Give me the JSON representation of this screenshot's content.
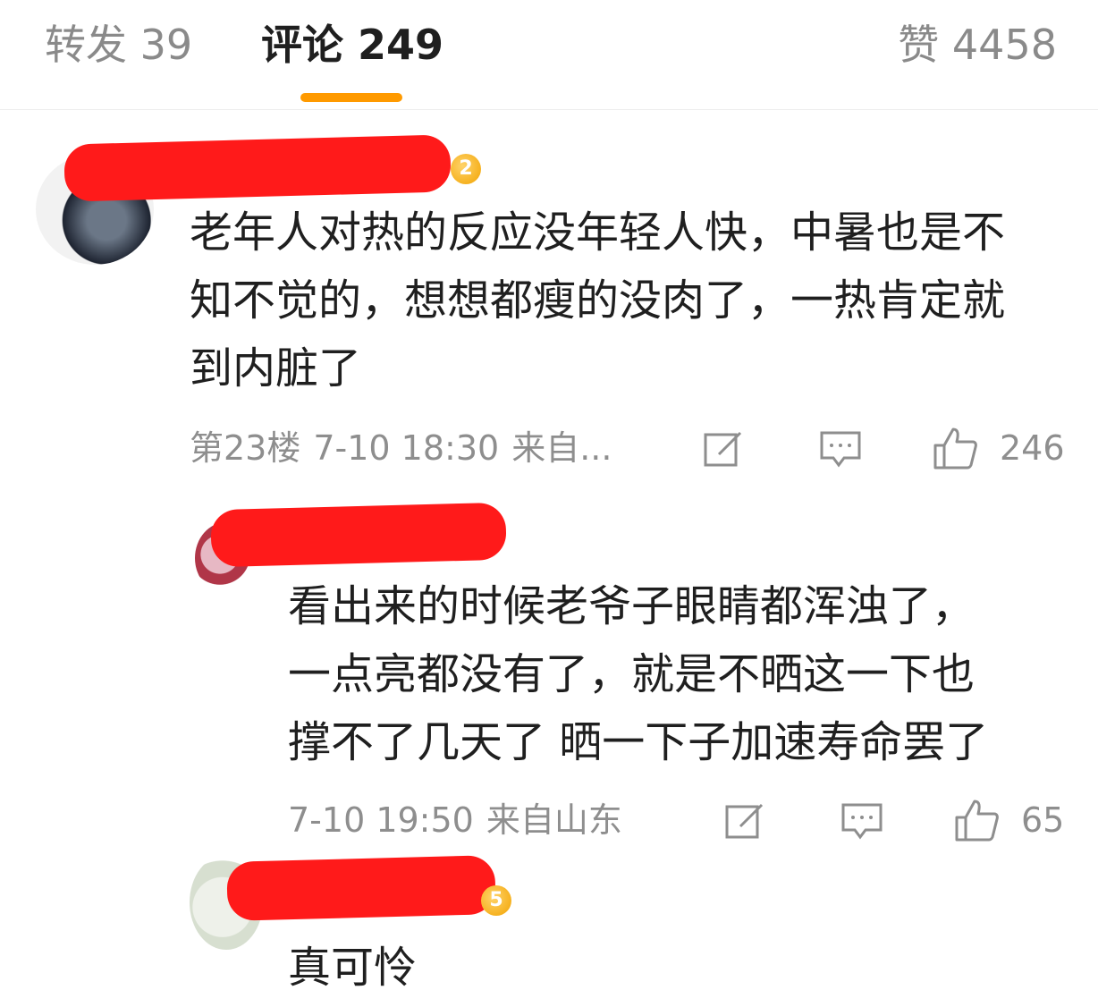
{
  "tabs": {
    "repost": "转发 39",
    "comments": "评论 249",
    "likes": "赞 4458"
  },
  "comments": [
    {
      "badge": "2",
      "text_lines": [
        "老年人对热的反应没年轻人快，中暑也是不",
        "知不觉的，想想都瘦的没肉了，一热肯定就",
        "到内脏了"
      ],
      "floor": "第23楼",
      "time": "7-10 18:30",
      "source": "来自...",
      "like_count": "246"
    },
    {
      "text_lines": [
        "看出来的时候老爷子眼睛都浑浊了，",
        "一点亮都没有了，就是不晒这一下也",
        "撑不了几天了  晒一下子加速寿命罢了"
      ],
      "time": "7-10 19:50",
      "source": "来自山东",
      "like_count": "65"
    },
    {
      "badge": "5",
      "text_lines": [
        "真可怜"
      ]
    }
  ],
  "icons": {
    "edit": "edit-square-icon",
    "reply": "comment-bubble-icon",
    "like": "thumbs-up-icon"
  },
  "colors": {
    "accent": "#ff9a00",
    "redaction": "#ff1a1a",
    "meta_text": "#8e8e8e"
  }
}
